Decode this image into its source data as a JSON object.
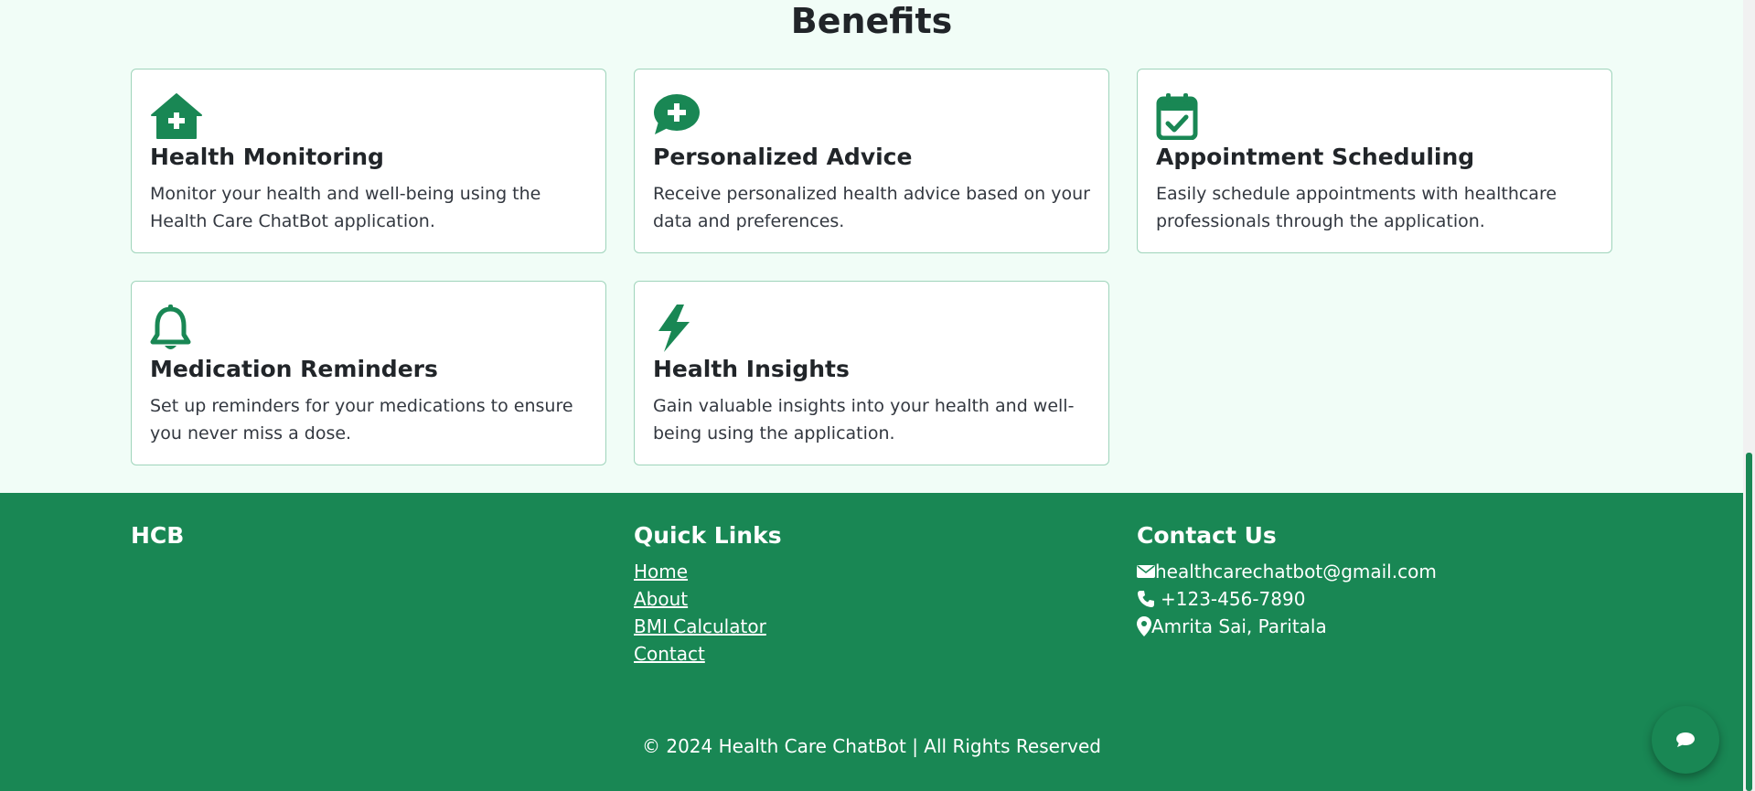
{
  "benefits": {
    "title": "Benefits",
    "cards": [
      {
        "icon": "house-medical-icon",
        "title": "Health Monitoring",
        "text": "Monitor your health and well-being using the Health Care ChatBot application."
      },
      {
        "icon": "comment-medical-icon",
        "title": "Personalized Advice",
        "text": "Receive personalized health advice based on your data and preferences."
      },
      {
        "icon": "calendar-check-icon",
        "title": "Appointment Scheduling",
        "text": "Easily schedule appointments with healthcare professionals through the application."
      },
      {
        "icon": "bell-icon",
        "title": "Medication Reminders",
        "text": "Set up reminders for your medications to ensure you never miss a dose."
      },
      {
        "icon": "bolt-icon",
        "title": "Health Insights",
        "text": "Gain valuable insights into your health and well-being using the application."
      }
    ]
  },
  "footer": {
    "brand": "HCB",
    "quick_links": {
      "title": "Quick Links",
      "items": [
        "Home",
        "About",
        "BMI Calculator",
        "Contact"
      ]
    },
    "contact": {
      "title": "Contact Us",
      "email": "healthcarechatbot@gmail.com",
      "phone": "+123-456-7890",
      "address": "Amrita Sai, Paritala"
    },
    "copyright": "© 2024 Health Care ChatBot | All Rights Reserved"
  },
  "chat_button": {
    "icon": "chat-icon"
  },
  "colors": {
    "brand_green": "#198754",
    "page_bg": "#f1fdf7",
    "card_border": "#9fd4bb"
  }
}
